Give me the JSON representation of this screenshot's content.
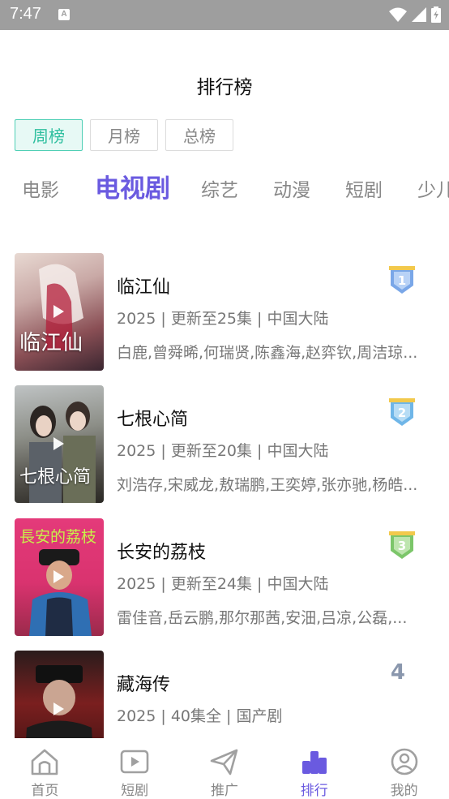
{
  "status_bar": {
    "time": "7:47",
    "a_glyph": "A"
  },
  "page_title": "排行榜",
  "period_tabs": [
    {
      "label": "周榜",
      "active": true
    },
    {
      "label": "月榜",
      "active": false
    },
    {
      "label": "总榜",
      "active": false
    }
  ],
  "category_tabs": [
    {
      "label": "电影"
    },
    {
      "label": "电视剧",
      "active": true
    },
    {
      "label": "综艺"
    },
    {
      "label": "动漫"
    },
    {
      "label": "短剧"
    },
    {
      "label": "少儿"
    }
  ],
  "items": [
    {
      "rank": "1",
      "title": "临江仙",
      "meta": "2025 | 更新至25集 | 中国大陆",
      "cast": "白鹿,曾舜晞,何瑞贤,陈鑫海,赵弈钦,周洁琼...",
      "poster_text": "临江仙",
      "badge_color": "#7aa7e8"
    },
    {
      "rank": "2",
      "title": "七根心简",
      "meta": "2025 | 更新至20集 | 中国大陆",
      "cast": "刘浩存,宋威龙,敖瑞鹏,王奕婷,张亦驰,杨皓...",
      "poster_text": "七根心简",
      "badge_color": "#6fb6e8"
    },
    {
      "rank": "3",
      "title": "长安的荔枝",
      "meta": "2025 | 更新至24集 | 中国大陆",
      "cast": "雷佳音,岳云鹏,那尔那茜,安沺,吕凉,公磊,...",
      "poster_text": "長安的荔枝",
      "badge_color": "#7cc66a"
    },
    {
      "rank": "4",
      "title": "藏海传",
      "meta": "2025 | 40集全 | 国产剧",
      "cast": "",
      "poster_text": "",
      "badge_color": ""
    }
  ],
  "bottom_nav": [
    {
      "label": "首页",
      "icon": "home-icon"
    },
    {
      "label": "短剧",
      "icon": "play-box-icon"
    },
    {
      "label": "推广",
      "icon": "paper-plane-icon"
    },
    {
      "label": "排行",
      "icon": "ranking-icon",
      "active": true
    },
    {
      "label": "我的",
      "icon": "user-icon"
    }
  ],
  "colors": {
    "accent": "#6a5ae0",
    "teal": "#2fbf9f"
  }
}
